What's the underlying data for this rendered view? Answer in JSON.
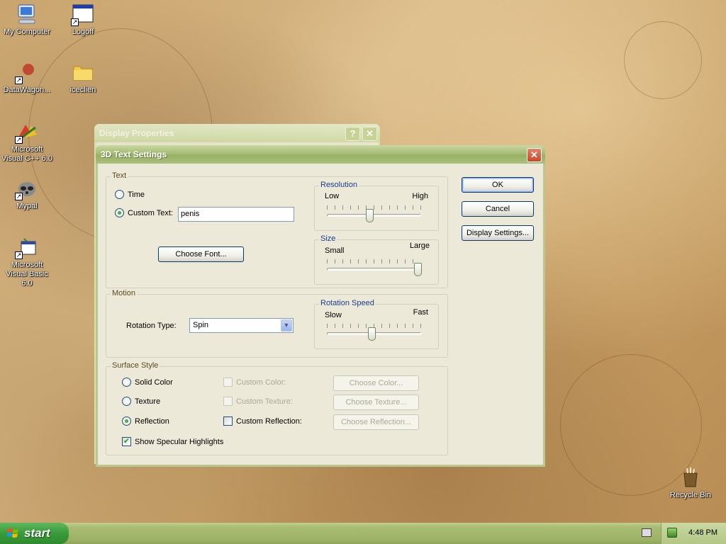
{
  "desktop": {
    "icons": [
      {
        "label": "My Computer"
      },
      {
        "label": "Logoff"
      },
      {
        "label": "DataWagon..."
      },
      {
        "label": "iceclien"
      },
      {
        "label": "Microsoft Visual C++ 6.0"
      },
      {
        "label": "Mypal"
      },
      {
        "label": "Microsoft Visual Basic 6.0"
      },
      {
        "label": "Recycle Bin"
      }
    ]
  },
  "background_window": {
    "title": "Display Properties",
    "help_icon": "question-mark-icon",
    "close_icon": "close-x-icon"
  },
  "dialog": {
    "title": "3D Text Settings",
    "close_icon": "close-x-icon",
    "text_group": {
      "legend": "Text",
      "time_label": "Time",
      "custom_text_label": "Custom Text:",
      "custom_text_value": "penis",
      "selected": "custom_text",
      "choose_font_button": "Choose Font..."
    },
    "resolution": {
      "legend": "Resolution",
      "low_label": "Low",
      "high_label": "High",
      "value_fraction": 0.45
    },
    "size": {
      "legend": "Size",
      "small_label": "Small",
      "large_label": "Large",
      "value_fraction": 1.0
    },
    "motion": {
      "legend": "Motion",
      "rotation_type_label": "Rotation Type:",
      "rotation_type_value": "Spin"
    },
    "rotation_speed": {
      "legend": "Rotation Speed",
      "slow_label": "Slow",
      "fast_label": "Fast",
      "value_fraction": 0.47
    },
    "surface_style": {
      "legend": "Surface Style",
      "solid_color_label": "Solid Color",
      "texture_label": "Texture",
      "reflection_label": "Reflection",
      "selected": "reflection",
      "custom_color_label": "Custom Color:",
      "custom_texture_label": "Custom Texture:",
      "custom_reflection_label": "Custom Reflection:",
      "choose_color_button": "Choose Color...",
      "choose_texture_button": "Choose Texture...",
      "choose_reflection_button": "Choose Reflection...",
      "specular_label": "Show Specular Highlights",
      "specular_checked": true
    },
    "buttons": {
      "ok": "OK",
      "cancel": "Cancel",
      "display_settings": "Display Settings..."
    }
  },
  "taskbar": {
    "start_label": "start",
    "clock": "4:48 PM"
  },
  "colors": {
    "title_bar": "#a6bc74",
    "dialog_face": "#ece9d8",
    "taskbar": "#a8bd73",
    "start_button": "#3a9a3a",
    "group_legend_text": "#5f4a1c",
    "slider_legend_text": "#1c3d8f"
  }
}
